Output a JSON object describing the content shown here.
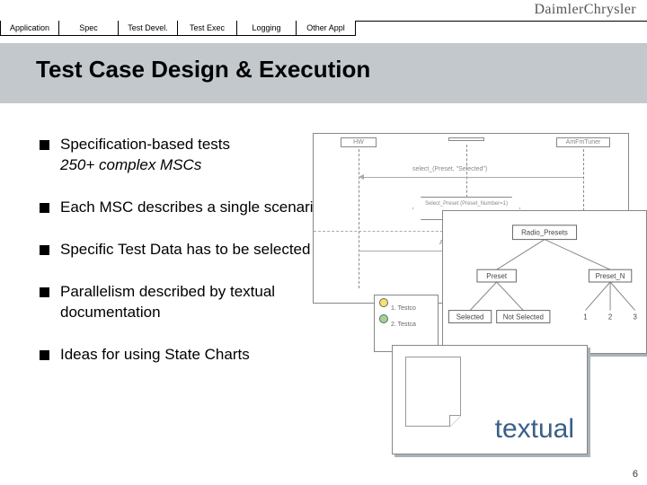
{
  "logo": {
    "part1": "Daimler",
    "part2": "Chrysler"
  },
  "tabs": [
    "Application",
    "Spec",
    "Test Devel.",
    "Test Exec",
    "Logging",
    "Other Appl"
  ],
  "title": "Test Case Design & Execution",
  "bullets": [
    {
      "main": "Specification-based tests",
      "sub": "250+ complex MSCs"
    },
    {
      "main": "Each MSC describes a single scenario"
    },
    {
      "main": "Specific Test Data has to be selected"
    },
    {
      "main": "Parallelism described by textual documentation"
    },
    {
      "main": "Ideas for using State Charts"
    }
  ],
  "msc": {
    "box1": "HW",
    "box2": "",
    "box3": "AmFmTuner",
    "arrow1_label": "select_(Preset, \"Selected\")",
    "cond": "Select_Preset (Preset_Number=1)",
    "arrow2_label": "Alternate"
  },
  "tree": {
    "root": "Radio_Presets",
    "l1": [
      "Preset",
      "Preset_N"
    ],
    "l2a": [
      "Selected",
      "Not Selected"
    ],
    "l2b": [
      "1",
      "2",
      "3"
    ]
  },
  "palette": {
    "row1": "1. Testco",
    "row2": "2. Testca"
  },
  "doc_caption": "textual",
  "page_number": "6"
}
